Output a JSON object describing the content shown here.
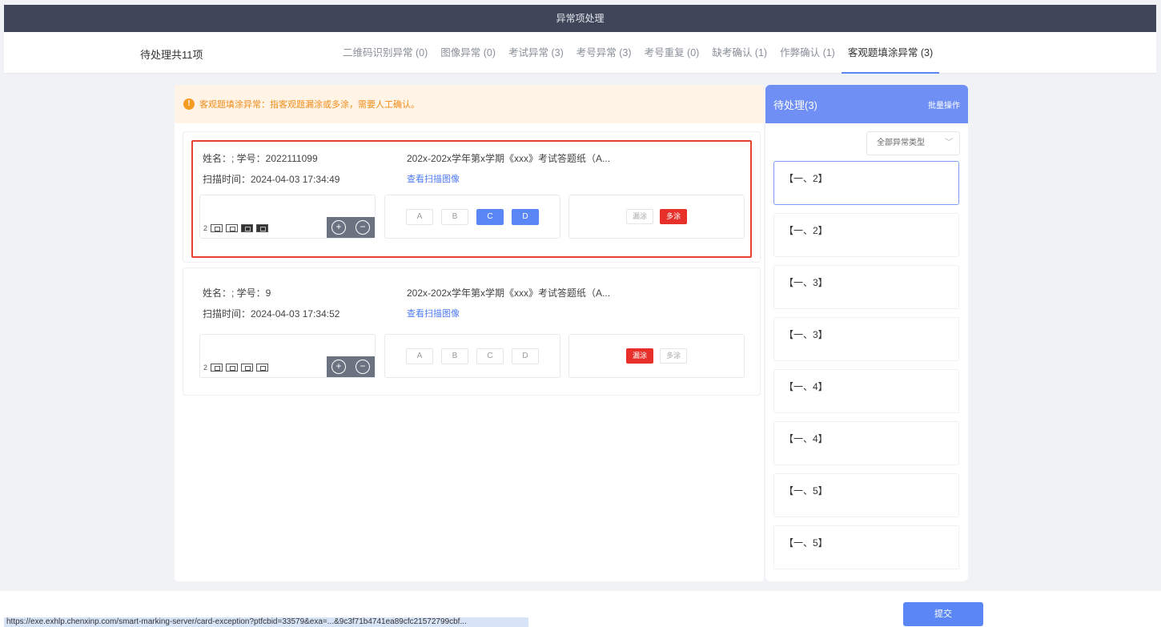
{
  "window": {
    "title": "异常项处理"
  },
  "header": {
    "pending_total": "待处理共11项",
    "tabs": [
      {
        "label": "二维码识别异常 (0)"
      },
      {
        "label": "图像异常 (0)"
      },
      {
        "label": "考试异常 (3)"
      },
      {
        "label": "考号异常 (3)"
      },
      {
        "label": "考号重复 (0)"
      },
      {
        "label": "缺考确认 (1)"
      },
      {
        "label": "作弊确认 (1)"
      },
      {
        "label": "客观题填涂异常 (3)",
        "active": true
      }
    ]
  },
  "notice": {
    "text": "客观题填涂异常：指客观题漏涂或多涂，需要人工确认。"
  },
  "cards": [
    {
      "student": "姓名：; 学号：2022111099",
      "scan_time": "扫描时间：2024-04-03 17:34:49",
      "exam": "202x-202x学年第x学期《xxx》考试答题纸（A...",
      "view_scan": "查看扫描图像",
      "thumb_num": "2",
      "options": [
        "A",
        "B",
        "C",
        "D"
      ],
      "options_selected": [
        "C",
        "D"
      ],
      "marks": [
        "漏涂",
        "多涂"
      ],
      "mark_active": "多涂"
    },
    {
      "student": "姓名：; 学号：9",
      "scan_time": "扫描时间：2024-04-03 17:34:52",
      "exam": "202x-202x学年第x学期《xxx》考试答题纸（A...",
      "view_scan": "查看扫描图像",
      "thumb_num": "2",
      "options": [
        "A",
        "B",
        "C",
        "D"
      ],
      "options_selected": [],
      "marks": [
        "漏涂",
        "多涂"
      ],
      "mark_active": "漏涂"
    }
  ],
  "sidebar": {
    "title": "待处理(3)",
    "batch": "批量操作",
    "filter": "全部异常类型",
    "items": [
      "【一、2】",
      "【一、2】",
      "【一、3】",
      "【一、3】",
      "【一、4】",
      "【一、4】",
      "【一、5】",
      "【一、5】"
    ]
  },
  "footer": {
    "submit": "提交",
    "url": "https://exe.exhlp.chenxinp.com/smart-marking-server/card-exception?ptfcbid=33579&exa=...&9c3f71b4741ea89cfc21572799cbf..."
  },
  "colors": {
    "accent": "#5b86f5",
    "danger": "#e8302b",
    "warning": "#f59a23",
    "titlebar": "#3f4659"
  }
}
